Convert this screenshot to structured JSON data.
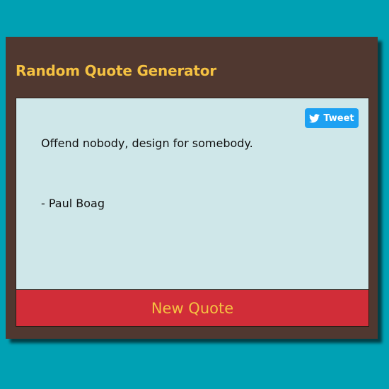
{
  "app": {
    "title": "Random Quote Generator"
  },
  "quote": {
    "text": "Offend nobody, design for somebody.",
    "author": "- Paul Boag"
  },
  "tweet_button": {
    "label": "Tweet",
    "icon": "twitter-bird-icon"
  },
  "new_quote_button": {
    "label": "New Quote"
  },
  "colors": {
    "page_background": "#00a1b4",
    "card_background": "#503830",
    "title_color": "#f5c242",
    "quote_panel": "#cfe7e9",
    "tweet_button": "#1da1f2",
    "new_quote_button": "#d12d38"
  }
}
